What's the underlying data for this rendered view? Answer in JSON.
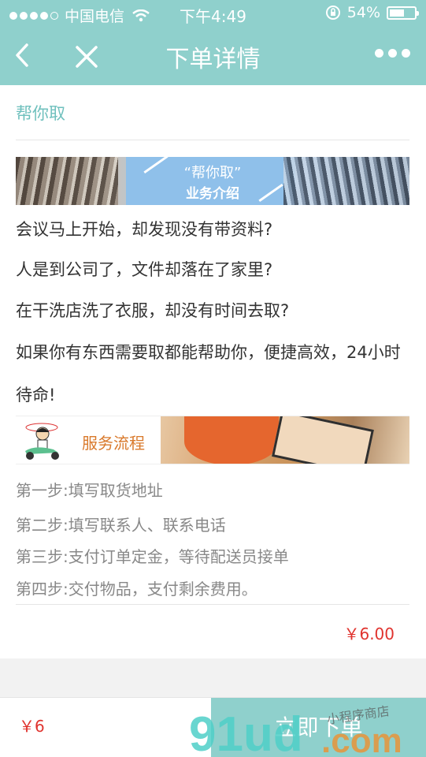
{
  "status_bar": {
    "carrier": "中国电信",
    "time": "下午4:49",
    "battery": "54%"
  },
  "nav": {
    "title": "下单详情"
  },
  "service": {
    "title": "帮你取",
    "banner_title": "“帮你取”",
    "banner_subtitle": "业务介绍",
    "intro_lines": [
      "会议马上开始，却发现没有带资料?",
      "人是到公司了，文件却落在了家里?",
      "在干洗店洗了衣服，却没有时间去取?",
      "如果你有东西需要取都能帮助你，便捷高效，24小时待命!"
    ],
    "process_label": "服务流程",
    "steps": [
      "第一步:填写取货地址",
      "第二步:填写联系人、联系电话",
      "第三步:支付订单定金，等待配送员接单",
      "第四步:交付物品，支付剩余费用。"
    ],
    "price": "￥6.00"
  },
  "bottom_bar": {
    "price": "￥6",
    "order_button": "立即下单"
  },
  "watermark": {
    "text1": "91ud.com",
    "text2": "小程序商店"
  },
  "colors": {
    "accent": "#8fd0cc",
    "price_red": "#e0332e",
    "process_orange": "#d9792b"
  }
}
